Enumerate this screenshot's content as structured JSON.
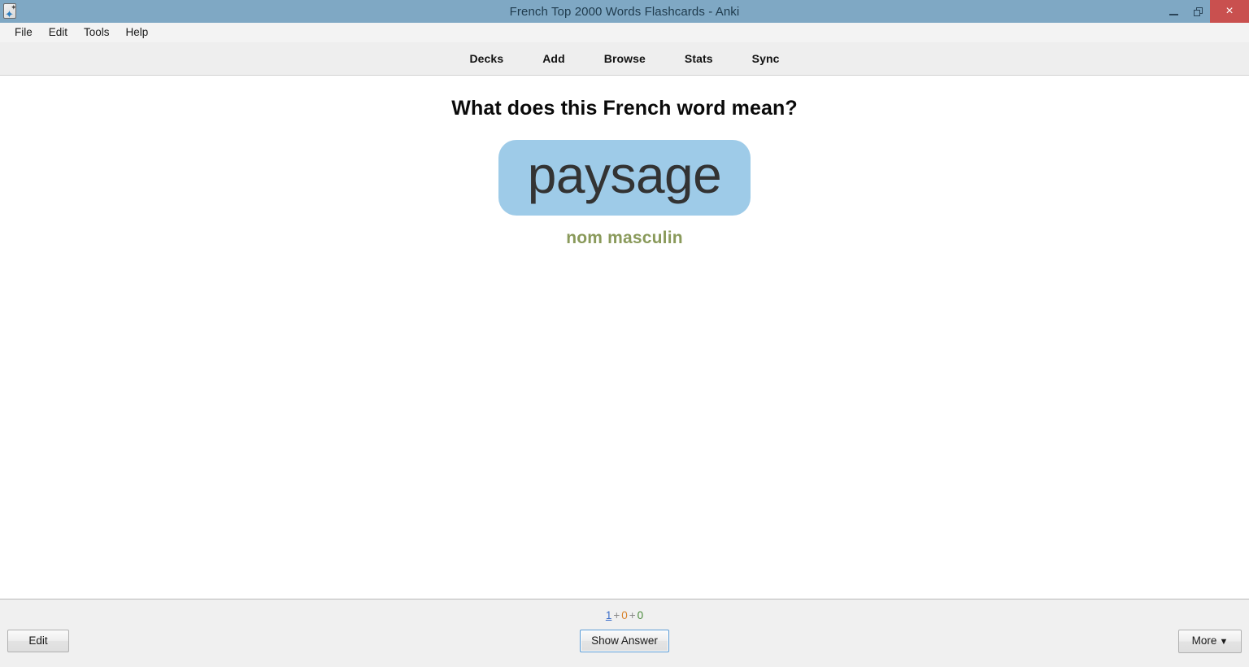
{
  "window": {
    "title": "French Top 2000 Words Flashcards - Anki",
    "app_icon": "anki-card-icon",
    "controls": {
      "minimize": "minimize-icon",
      "maximize": "restore-icon",
      "close": "×"
    },
    "colors": {
      "titlebar": "#7fa8c4",
      "close_button": "#c9504f",
      "chip": "#9ecbe8",
      "pos_text": "#8a9a5b",
      "new_count": "#3c6ec9",
      "learn_count": "#d9822b",
      "due_count": "#4a8a3c"
    }
  },
  "menubar": {
    "items": [
      {
        "label": "File"
      },
      {
        "label": "Edit"
      },
      {
        "label": "Tools"
      },
      {
        "label": "Help"
      }
    ]
  },
  "toolbar": {
    "items": [
      {
        "label": "Decks"
      },
      {
        "label": "Add"
      },
      {
        "label": "Browse"
      },
      {
        "label": "Stats"
      },
      {
        "label": "Sync"
      }
    ]
  },
  "card": {
    "question": "What does this French word mean?",
    "word": "paysage",
    "part_of_speech": "nom masculin"
  },
  "bottom": {
    "counts": {
      "new": "1",
      "separator1": "+",
      "learning": "0",
      "separator2": "+",
      "due": "0"
    },
    "edit_label": "Edit",
    "show_answer_label": "Show Answer",
    "more_label": "More",
    "more_caret": "▼"
  }
}
